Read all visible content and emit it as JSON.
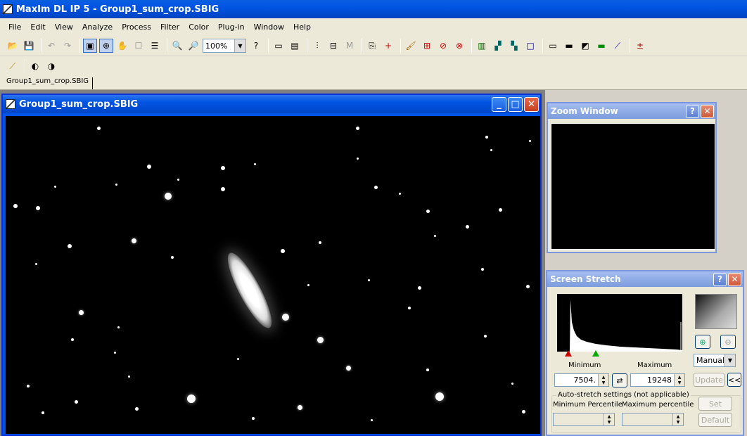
{
  "app": {
    "title": "MaxIm DL IP 5 - Group1_sum_crop.SBIG"
  },
  "menu": [
    "File",
    "Edit",
    "View",
    "Analyze",
    "Process",
    "Filter",
    "Color",
    "Plug-in",
    "Window",
    "Help"
  ],
  "toolbar": {
    "zoom_value": "100%"
  },
  "tabs": {
    "document": "Group1_sum_crop.SBIG"
  },
  "image_window": {
    "title": "Group1_sum_crop.SBIG"
  },
  "zoom_window": {
    "title": "Zoom Window"
  },
  "screen_stretch": {
    "title": "Screen Stretch",
    "minimum_label": "Minimum",
    "maximum_label": "Maximum",
    "minimum_value": "7504.",
    "maximum_value": "19248",
    "mode": "Manual",
    "update_label": "Update",
    "collapse_label": "<<",
    "swap_label": "⇄",
    "auto_group_title": "Auto-stretch settings (not applicable)",
    "min_percentile_label": "Minimum Percentile",
    "max_percentile_label": "Maximum percentile",
    "set_label": "Set",
    "default_label": "Default"
  },
  "colors": {
    "title_blue": "#0054e3",
    "panel_blue": "#7b9cdd",
    "background": "#d4d0c8"
  }
}
